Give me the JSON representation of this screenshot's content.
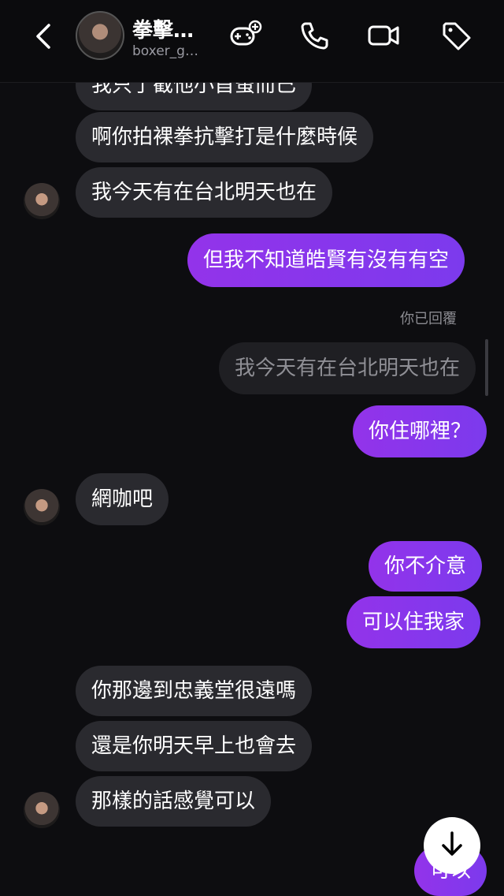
{
  "header": {
    "title": "拳擊…",
    "subtitle": "boxer_g…",
    "icons": [
      "back-chevron-icon",
      "gamepad-add-icon",
      "phone-icon",
      "video-icon",
      "tag-icon"
    ]
  },
  "messages": [
    {
      "text": "我只了截他小首蚤而已",
      "dir": "in"
    },
    {
      "text": "啊你拍裸拳抗擊打是什麼時候",
      "dir": "in"
    },
    {
      "text": "我今天有在台北明天也在",
      "dir": "in"
    },
    {
      "text": "但我不知道皓賢有沒有有空",
      "dir": "out"
    },
    {
      "text": "你已回覆",
      "dir": "meta"
    },
    {
      "text": "我今天有在台北明天也在",
      "dir": "quoted"
    },
    {
      "text": "你住哪裡？",
      "dir": "out"
    },
    {
      "text": "網咖吧",
      "dir": "in"
    },
    {
      "text": "你不介意",
      "dir": "out"
    },
    {
      "text": "可以住我家",
      "dir": "out"
    },
    {
      "text": "你那邊到忠義堂很遠嗎",
      "dir": "in"
    },
    {
      "text": "還是你明天早上也會去",
      "dir": "in"
    },
    {
      "text": "那樣的話感覺可以",
      "dir": "in"
    },
    {
      "text": "可以",
      "dir": "out"
    }
  ],
  "scroll_button": {
    "icon": "arrow-down-icon"
  },
  "colors": {
    "outgoing": "#8b35e6",
    "incoming": "#2a2a2f",
    "background": "#0d0d10"
  }
}
